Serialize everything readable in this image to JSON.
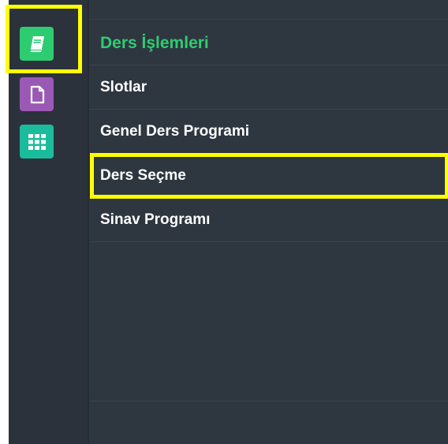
{
  "rail": {
    "items": [
      {
        "icon": "book-icon",
        "color": "#2ecc71"
      },
      {
        "icon": "document-icon",
        "color": "#9b59b6"
      },
      {
        "icon": "grid-icon",
        "color": "#1abc9c"
      }
    ]
  },
  "menu": {
    "title": "Ders İşlemleri",
    "title_color": "#2ecc71",
    "items": [
      {
        "label": "Slotlar"
      },
      {
        "label": "Genel Ders Programi"
      },
      {
        "label": "Ders Seçme"
      },
      {
        "label": "Sinav Programı"
      }
    ]
  },
  "colors": {
    "panel_bg": "#2e3640",
    "rail_bg": "#2b323b",
    "highlight": "#ffff00"
  }
}
